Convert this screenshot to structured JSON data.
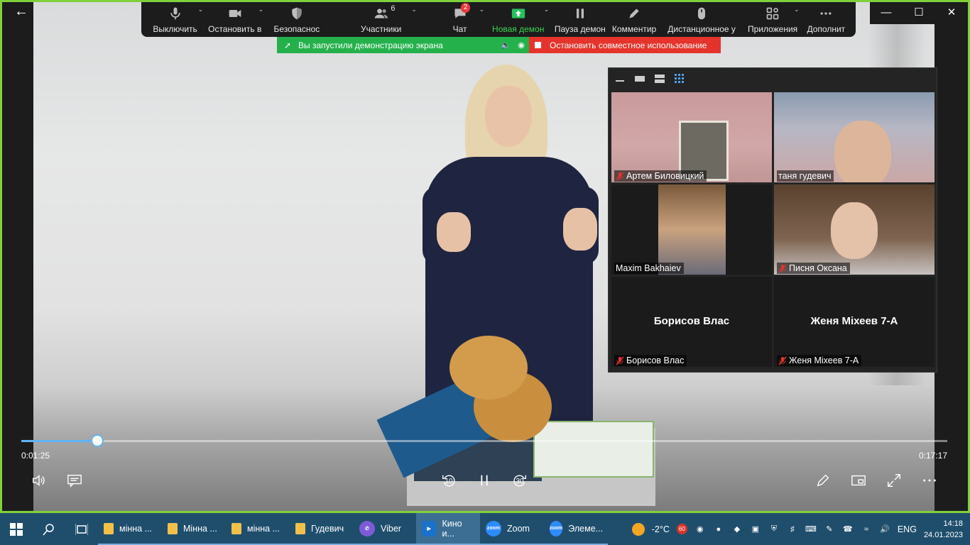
{
  "zoom_toolbar": {
    "items": [
      {
        "label": "Выключить",
        "icon": "microphone-icon"
      },
      {
        "label": "Остановить в",
        "icon": "video-camera-icon"
      },
      {
        "label": "Безопаснос",
        "icon": "shield-icon"
      },
      {
        "label": "Участники",
        "icon": "participants-icon",
        "count": "6"
      },
      {
        "label": "Чат",
        "icon": "chat-icon",
        "badge": "2"
      },
      {
        "label": "Новая демон",
        "icon": "share-screen-icon"
      },
      {
        "label": "Пауза демон",
        "icon": "pause-icon"
      },
      {
        "label": "Комментир",
        "icon": "pencil-icon"
      },
      {
        "label": "Дистанционное у",
        "icon": "mouse-icon"
      },
      {
        "label": "Приложения",
        "icon": "apps-icon"
      },
      {
        "label": "Дополнит",
        "icon": "more-icon"
      }
    ]
  },
  "share_banner": {
    "message": "Вы запустили демонстрацию экрана",
    "stop_label": "Остановить совместное использование",
    "color": "#24b14c",
    "stop_color": "#e5342b"
  },
  "gallery": {
    "participants": [
      {
        "name": "Артем Биловицкий",
        "muted": true,
        "active_speaker": true
      },
      {
        "name": "таня гудевич",
        "muted": false
      },
      {
        "name": "Maxim Bakhaiev",
        "muted": false
      },
      {
        "name": "Писня Оксана",
        "muted": true
      },
      {
        "name": "Борисов Влас",
        "muted": true,
        "video_off": true
      },
      {
        "name": "Женя Міхеев 7-А",
        "muted": true,
        "video_off": true
      }
    ]
  },
  "player": {
    "current_time": "0:01:25",
    "total_time": "0:17:17",
    "progress": 0.082,
    "skip_back_label": "10",
    "skip_forward_label": "30",
    "accent": "#5fb4f3"
  },
  "taskbar": {
    "tasks": [
      {
        "label": "мінна ...",
        "icon": "folder-icon"
      },
      {
        "label": "Мінна ...",
        "icon": "folder-icon"
      },
      {
        "label": "мінна ...",
        "icon": "folder-icon"
      },
      {
        "label": "Гудевич",
        "icon": "folder-icon"
      },
      {
        "label": "Viber",
        "icon": "viber-icon"
      },
      {
        "label": "Кино и...",
        "icon": "movies-icon",
        "active": true
      },
      {
        "label": "Zoom",
        "icon": "zoom-icon"
      },
      {
        "label": "Элеме...",
        "icon": "zoom-icon"
      }
    ],
    "weather": "-2°C",
    "badge_count": "60",
    "language": "ENG",
    "time": "14:18",
    "date": "24.01.2023"
  }
}
